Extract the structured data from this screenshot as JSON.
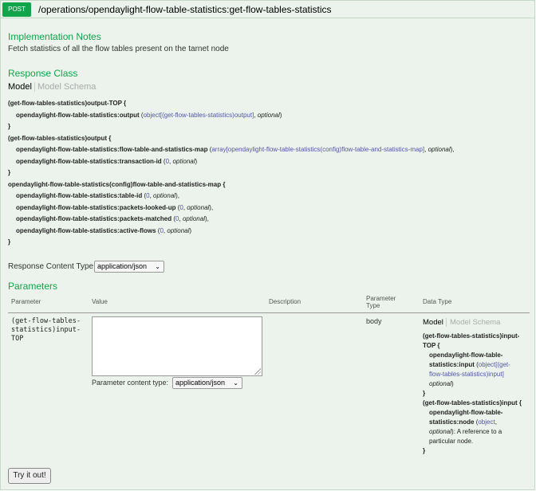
{
  "operation": {
    "method": "POST",
    "path": "/operations/opendaylight-flow-table-statistics:get-flow-tables-statistics"
  },
  "implementation_notes": {
    "heading": "Implementation Notes",
    "text": "Fetch statistics of all the flow tables present on the tarnet node"
  },
  "response_class": {
    "heading": "Response Class",
    "tabs": [
      "Model",
      "Model Schema"
    ],
    "model": {
      "b1_title": "(get-flow-tables-statistics)output-TOP {",
      "b1_l1_name": "opendaylight-flow-table-statistics:output",
      "b1_l1_type": "object[(get-flow-tables-statistics)output]",
      "b1_close": "}",
      "b2_title": "(get-flow-tables-statistics)output {",
      "b2_l1_name": "opendaylight-flow-table-statistics:flow-table-and-statistics-map",
      "b2_l1_type": "array[opendaylight-flow-table-statistics(config)flow-table-and-statistics-map]",
      "b2_l2_name": "opendaylight-flow-table-statistics:transaction-id",
      "b2_l2_type": "0",
      "b2_close": "}",
      "b3_title": "opendaylight-flow-table-statistics(config)flow-table-and-statistics-map {",
      "b3_l1_name": "opendaylight-flow-table-statistics:table-id",
      "b3_l2_name": "opendaylight-flow-table-statistics:packets-looked-up",
      "b3_l3_name": "opendaylight-flow-table-statistics:packets-matched",
      "b3_l4_name": "opendaylight-flow-table-statistics:active-flows",
      "num_type": "0",
      "b3_close": "}",
      "optional": "optional",
      "open_paren": " (",
      "close_paren_comma": "),",
      "close_paren": ")",
      "comma_sp": ", "
    }
  },
  "response_content_type": {
    "label": "Response Content Type",
    "selected": "application/json"
  },
  "parameters": {
    "heading": "Parameters",
    "columns": [
      "Parameter",
      "Value",
      "Description",
      "Parameter Type",
      "Data Type"
    ],
    "param_type_line1": "Parameter",
    "param_type_line2": "Type",
    "row": {
      "name_l1": "(get-flow-tables-",
      "name_l2": "statistics)input-",
      "name_l3": "TOP",
      "value": "",
      "param_type": "body",
      "content_type_label": "Parameter content type:",
      "content_type_selected": "application/json",
      "data_type_tabs": [
        "Model",
        "Model Schema"
      ],
      "dt": {
        "a1": "(get-flow-tables-statistics)input-",
        "a2": "TOP {",
        "a3": "opendaylight-flow-table-",
        "a4": "statistics:input",
        "a4_type": "object[(get-",
        "a5": "flow-tables-statistics)input]",
        "a6": "optional",
        "a_close": "}",
        "b1": "(get-flow-tables-statistics)input {",
        "b2": "opendaylight-flow-table-",
        "b3": "statistics:node",
        "b3_type": "object",
        "b4_opt": "optional",
        "b4_desc": ": A reference to a",
        "b5": "particular node.",
        "b_close": "}"
      }
    }
  },
  "try_button": "Try it out!"
}
